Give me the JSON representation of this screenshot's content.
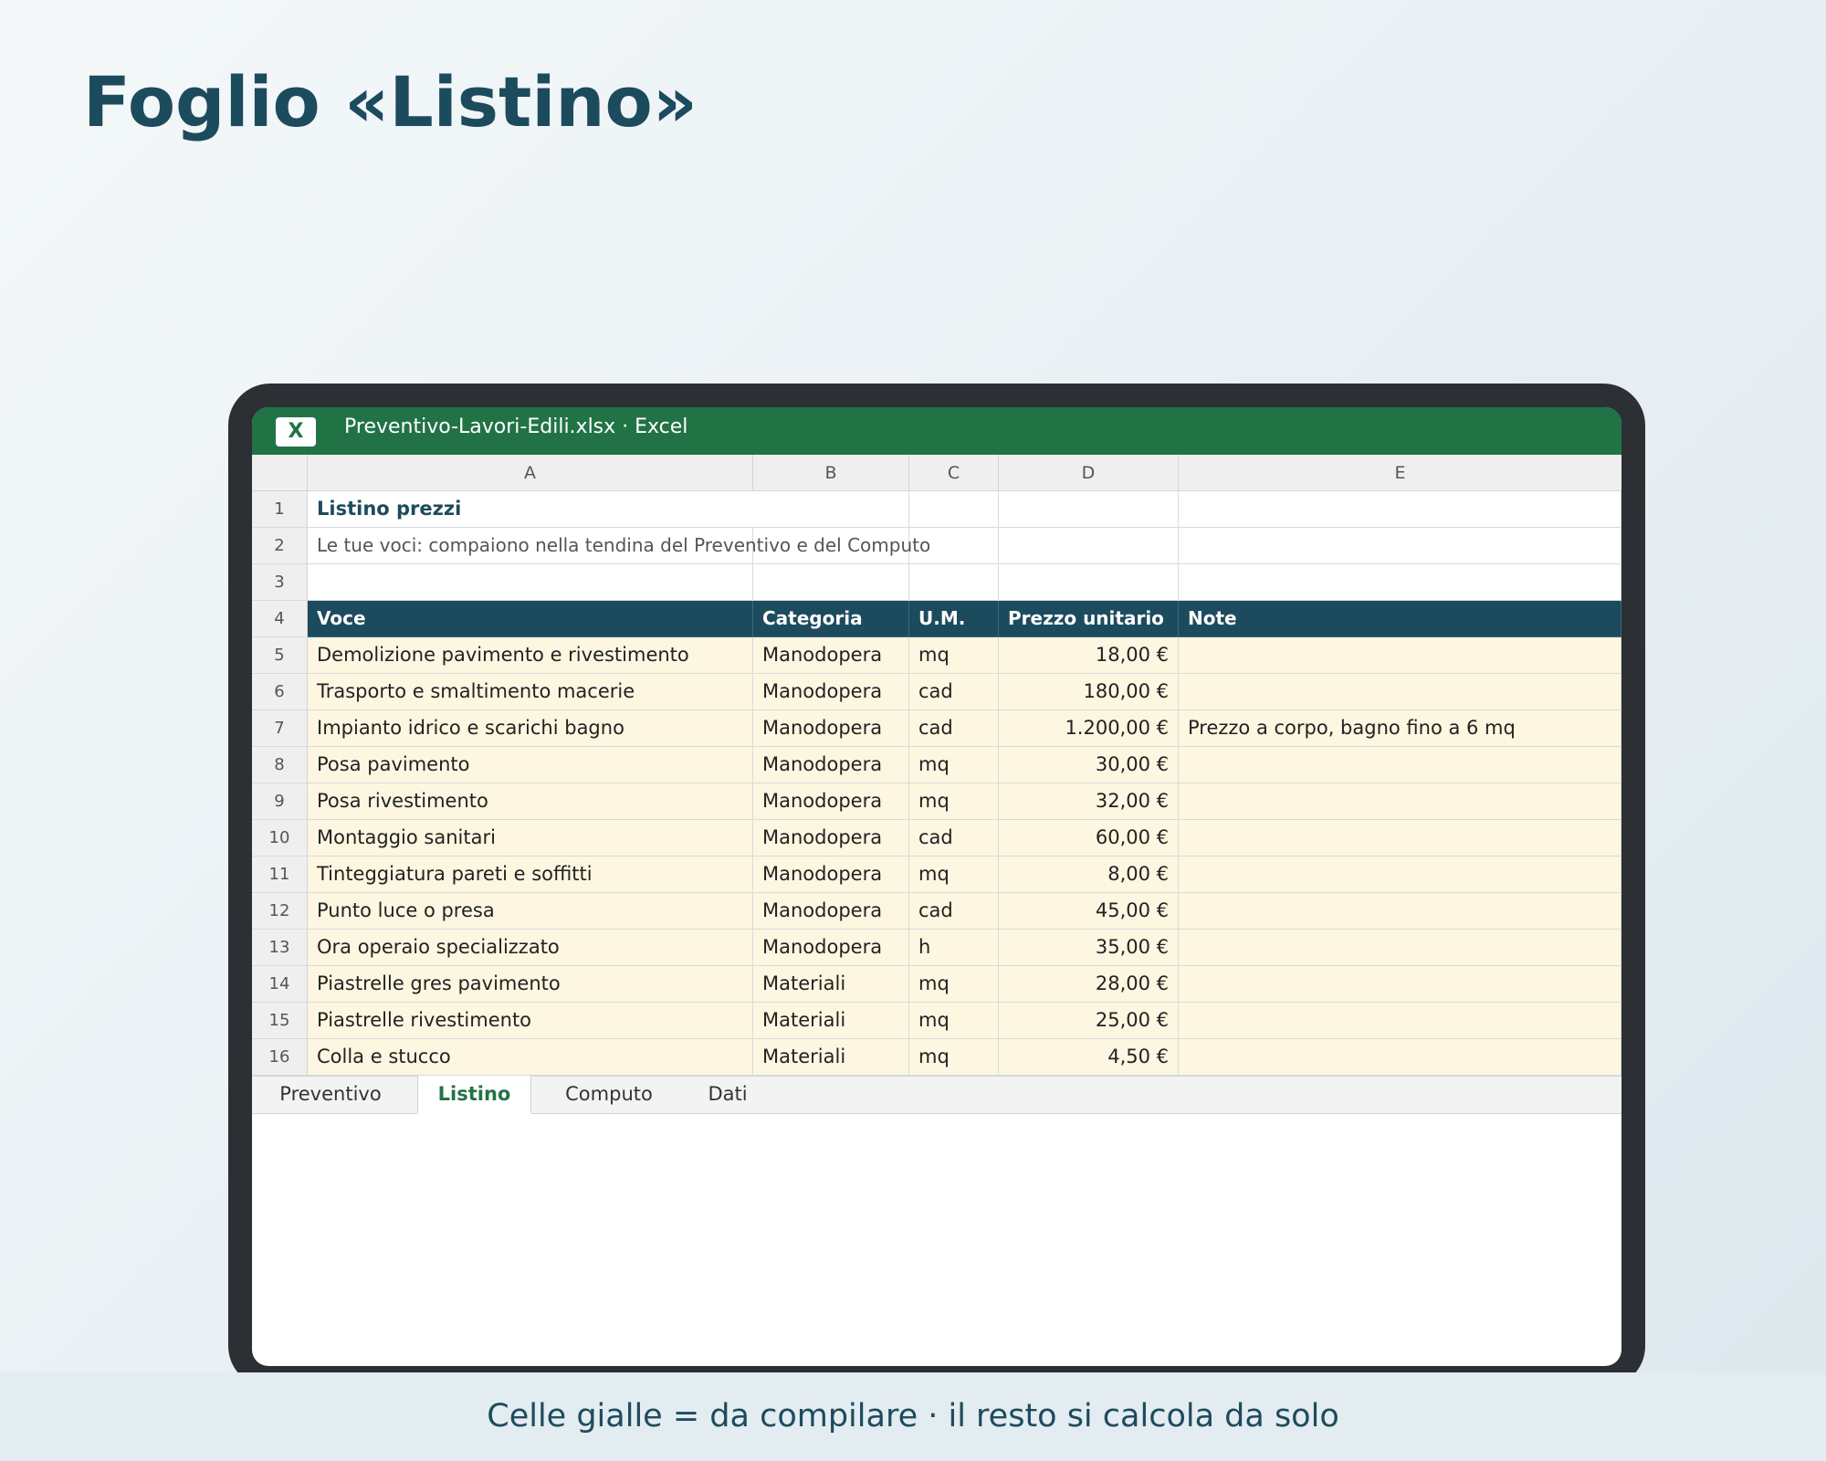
{
  "page": {
    "title": "Foglio «Listino»"
  },
  "window": {
    "app_icon": "excel-x-icon",
    "app_letter": "X",
    "title": "Preventivo-Lavori-Edili.xlsx · Excel"
  },
  "sheet": {
    "columns": [
      "A",
      "B",
      "C",
      "D",
      "E"
    ],
    "row_numbers": [
      "1",
      "2",
      "3",
      "4",
      "5",
      "6",
      "7",
      "8",
      "9",
      "10",
      "11",
      "12",
      "13",
      "14",
      "15",
      "16"
    ],
    "title": "Listino prezzi",
    "subtitle": "Le tue voci: compaiono nella tendina del Preventivo e del Computo",
    "headers": [
      "Voce",
      "Categoria",
      "U.M.",
      "Prezzo unitario",
      "Note"
    ],
    "rows": [
      [
        "Demolizione pavimento e rivestimento",
        "Manodopera",
        "mq",
        "18,00 €",
        ""
      ],
      [
        "Trasporto e smaltimento macerie",
        "Manodopera",
        "cad",
        "180,00 €",
        ""
      ],
      [
        "Impianto idrico e scarichi bagno",
        "Manodopera",
        "cad",
        "1.200,00 €",
        "Prezzo a corpo, bagno fino a 6 mq"
      ],
      [
        "Posa pavimento",
        "Manodopera",
        "mq",
        "30,00 €",
        ""
      ],
      [
        "Posa rivestimento",
        "Manodopera",
        "mq",
        "32,00 €",
        ""
      ],
      [
        "Montaggio sanitari",
        "Manodopera",
        "cad",
        "60,00 €",
        ""
      ],
      [
        "Tinteggiatura pareti e soffitti",
        "Manodopera",
        "mq",
        "8,00 €",
        ""
      ],
      [
        "Punto luce o presa",
        "Manodopera",
        "cad",
        "45,00 €",
        ""
      ],
      [
        "Ora operaio specializzato",
        "Manodopera",
        "h",
        "35,00 €",
        ""
      ],
      [
        "Piastrelle gres pavimento",
        "Materiali",
        "mq",
        "28,00 €",
        ""
      ],
      [
        "Piastrelle rivestimento",
        "Materiali",
        "mq",
        "25,00 €",
        ""
      ],
      [
        "Colla e stucco",
        "Materiali",
        "mq",
        "4,50 €",
        ""
      ]
    ]
  },
  "tabs": [
    {
      "label": "Preventivo",
      "active": false
    },
    {
      "label": "Listino",
      "active": true
    },
    {
      "label": "Computo",
      "active": false
    },
    {
      "label": "Dati",
      "active": false
    }
  ],
  "footer": {
    "text": "Celle gialle = da compilare · il resto si calcola da solo"
  },
  "colors": {
    "accent": "#217346",
    "header": "#1d4b5e",
    "input_cells": "#fdf6e0"
  }
}
